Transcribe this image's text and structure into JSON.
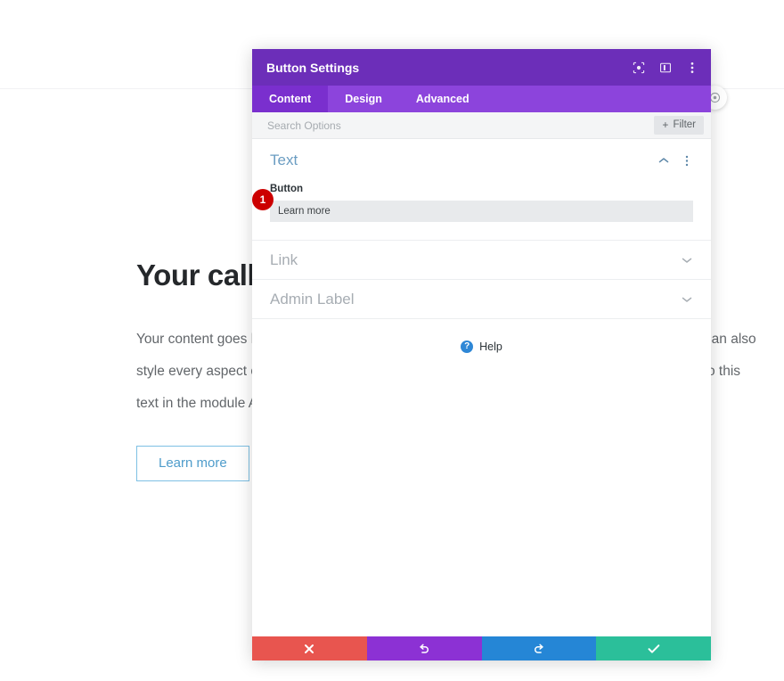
{
  "background": {
    "heading": "Your call to action goes here",
    "paragraph": "Your content goes here. Edit or remove this text inline or in the module Content settings. You can also style every aspect of this content in the module Design settings and even apply custom CSS to this text in the module Advanced settings.",
    "button_label": "Learn more",
    "floating_button_icon": "settings-gear-icon"
  },
  "modal": {
    "title": "Button Settings",
    "header_icons": [
      {
        "name": "focus-target-icon"
      },
      {
        "name": "layout-panel-icon"
      },
      {
        "name": "more-vertical-icon"
      }
    ],
    "tabs": [
      {
        "label": "Content",
        "active": true
      },
      {
        "label": "Design",
        "active": false
      },
      {
        "label": "Advanced",
        "active": false
      }
    ],
    "search": {
      "placeholder": "Search Options",
      "value": ""
    },
    "filter": {
      "label": "Filter",
      "plus": "+"
    },
    "sections": {
      "text": {
        "title": "Text",
        "collapse_icon": "chevron-up-icon",
        "menu_icon": "more-vertical-icon",
        "field_label": "Button",
        "field_value": "Learn more",
        "step_badge": "1"
      },
      "link": {
        "title": "Link",
        "expand_icon": "chevron-down-icon"
      },
      "admin_label": {
        "title": "Admin Label",
        "expand_icon": "chevron-down-icon"
      }
    },
    "help": {
      "label": "Help",
      "icon_glyph": "?"
    },
    "footer_buttons": [
      {
        "name": "discard-button",
        "icon": "close-x-icon",
        "color": "#e8554f"
      },
      {
        "name": "undo-button",
        "icon": "undo-arrow-icon",
        "color": "#8c31d4"
      },
      {
        "name": "redo-button",
        "icon": "redo-arrow-icon",
        "color": "#2586d6"
      },
      {
        "name": "save-button",
        "icon": "check-icon",
        "color": "#2bbf9a"
      }
    ]
  },
  "colors": {
    "header_purple": "#6c2eb9",
    "tabs_purple": "#8c44dc",
    "active_tab_purple": "#7a2fce",
    "badge_red": "#cc0000",
    "link_blue": "#6b9dc2"
  }
}
